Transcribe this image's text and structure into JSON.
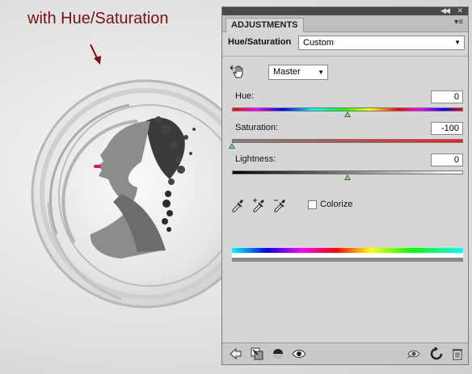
{
  "annotation": {
    "text": "with Hue/Saturation"
  },
  "panel": {
    "tab_label": "ADJUSTMENTS",
    "preset_label": "Hue/Saturation",
    "preset_value": "Custom",
    "channel_value": "Master",
    "sliders": [
      {
        "label": "Hue:",
        "value": "0",
        "position": 0.5
      },
      {
        "label": "Saturation:",
        "value": "-100",
        "position": 0.0
      },
      {
        "label": "Lightness:",
        "value": "0",
        "position": 0.5
      }
    ],
    "colorize_label": "Colorize",
    "colorize_checked": false,
    "icons": {
      "hand": "targeted-adjustment-hand-icon",
      "eyedroppers": [
        "eyedropper-icon",
        "eyedropper-plus-icon",
        "eyedropper-minus-icon"
      ],
      "bottom_left": [
        "back-arrow-icon",
        "clip-to-layer-icon",
        "mask-icon",
        "visibility-eye-icon"
      ],
      "bottom_right": [
        "view-previous-icon",
        "reset-icon",
        "trash-icon"
      ]
    }
  },
  "colors": {
    "annotation": "#7a1010",
    "panel_bg": "#d6d6d6",
    "slider_thumb": "#2f7a2f"
  }
}
